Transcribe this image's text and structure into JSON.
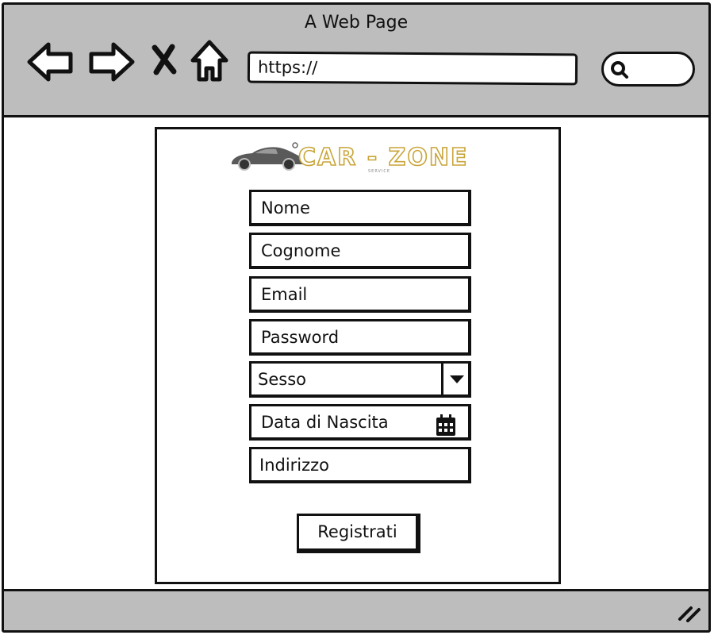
{
  "browser": {
    "title": "A Web Page",
    "url": "https://",
    "icons": {
      "back": "arrow-left-icon",
      "forward": "arrow-right-icon",
      "stop": "close-icon",
      "home": "home-icon",
      "search": "search-icon",
      "resize": "resize-grip-icon"
    }
  },
  "logo": {
    "text": "CAR - ZONE",
    "subtext": "SERVICE",
    "brand_color": "#c9a53b"
  },
  "form": {
    "fields": {
      "nome": "Nome",
      "cognome": "Cognome",
      "email": "Email",
      "password": "Password",
      "sesso": "Sesso",
      "data_nascita": "Data di Nascita",
      "indirizzo": "Indirizzo"
    },
    "submit_label": "Registrati"
  },
  "colors": {
    "chrome_background": "#bdbdbd",
    "border": "#111111"
  }
}
